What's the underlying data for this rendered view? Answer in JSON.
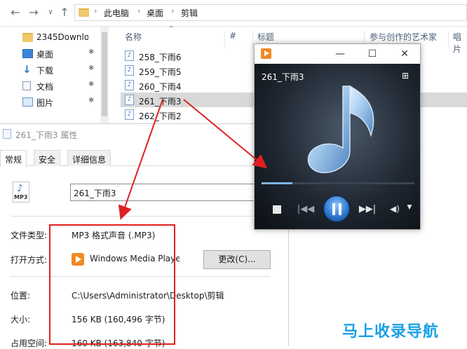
{
  "explorer": {
    "breadcrumbs": [
      "此电脑",
      "桌面",
      "剪辑"
    ],
    "nav_items": [
      {
        "label": "2345Downlo",
        "icon": "folder-icon",
        "pinned": false
      },
      {
        "label": "桌面",
        "icon": "desktop-icon",
        "pinned": true
      },
      {
        "label": "下载",
        "icon": "download-icon",
        "pinned": true
      },
      {
        "label": "文档",
        "icon": "document-icon",
        "pinned": true
      },
      {
        "label": "图片",
        "icon": "picture-icon",
        "pinned": true
      }
    ],
    "columns": [
      "名称",
      "#",
      "标题",
      "参与创作的艺术家",
      "唱片"
    ],
    "files": [
      {
        "name": "258_下雨6",
        "selected": false
      },
      {
        "name": "259_下雨5",
        "selected": false
      },
      {
        "name": "260_下雨4",
        "selected": false
      },
      {
        "name": "261_下雨3",
        "selected": true
      },
      {
        "name": "262_下雨2",
        "selected": false
      }
    ]
  },
  "properties": {
    "title": "261_下雨3 属性",
    "tabs": [
      "常规",
      "安全",
      "详细信息"
    ],
    "active_tab": "常规",
    "icon_label": "MP3",
    "file_name": "261_下雨3",
    "type_label": "文件类型:",
    "type_value": "MP3 格式声音 (.MP3)",
    "open_label": "打开方式:",
    "open_value": "Windows Media Playe",
    "change_button": "更改(C)...",
    "location_label": "位置:",
    "location_value": "C:\\Users\\Administrator\\Desktop\\剪辑",
    "size_label": "大小:",
    "size_value": "156 KB (160,496 字节)",
    "disk_label": "占用空间:",
    "disk_value": "160 KB (163,840 字节)"
  },
  "player": {
    "track_title": "261_下雨3",
    "progress": 0.2
  },
  "watermark": "马上收录导航",
  "colors": {
    "annotation": "#e02020",
    "watermark": "#1aa0e6",
    "wmp_orange": "#f08a24"
  }
}
